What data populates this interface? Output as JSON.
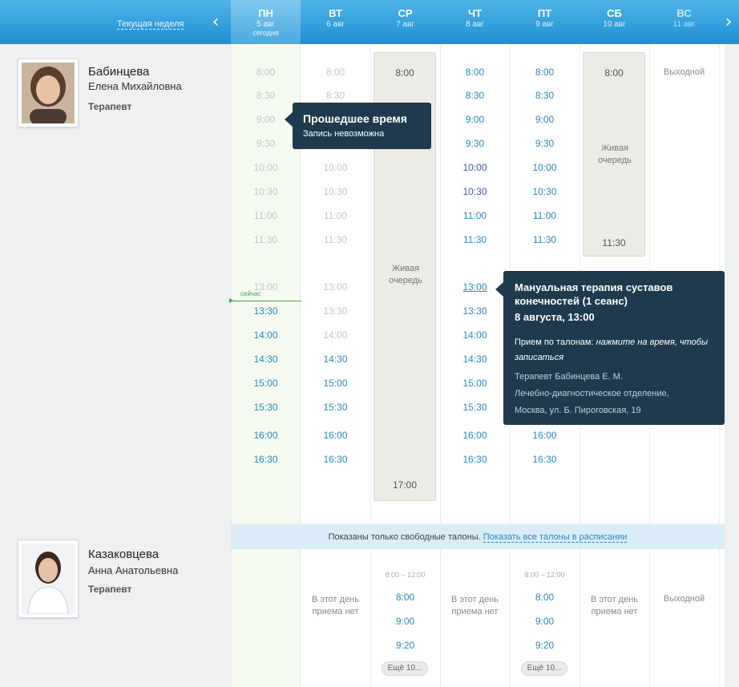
{
  "header": {
    "week_link": "Текущая неделя",
    "prev_icon": "chevron-left-icon",
    "next_icon": "chevron-right-icon",
    "days": [
      {
        "name": "ПН",
        "date": "5 авг",
        "note": "сегодня"
      },
      {
        "name": "ВТ",
        "date": "6 авг",
        "note": ""
      },
      {
        "name": "СР",
        "date": "7 авг",
        "note": ""
      },
      {
        "name": "ЧТ",
        "date": "8 авг",
        "note": ""
      },
      {
        "name": "ПТ",
        "date": "9 авг",
        "note": ""
      },
      {
        "name": "СБ",
        "date": "10 авг",
        "note": ""
      },
      {
        "name": "ВС",
        "date": "11 авг",
        "note": ""
      }
    ]
  },
  "doctor1": {
    "surname": "Бабинцева",
    "name": "Елена Михайловна",
    "spec": "Терапевт",
    "mon_past": [
      "8:00",
      "8:30",
      "9:00",
      "9:30",
      "10:00",
      "10:30",
      "11:00",
      "11:30",
      "13:00"
    ],
    "mon_free": [
      "13:30",
      "14:00",
      "14:30",
      "15:00",
      "15:30",
      "16:00",
      "16:30"
    ],
    "now_label": "сейчас",
    "tue_past": [
      "8:00",
      "8:30",
      "10:00",
      "10:30",
      "11:00",
      "11:30",
      "13:00",
      "13:30",
      "14:00"
    ],
    "tue_free": [
      "14:30",
      "15:00",
      "15:30",
      "16:00",
      "16:30"
    ],
    "wed_start": "8:00",
    "wed_live": "Живая очередь",
    "wed_end": "17:00",
    "thu_free_am": [
      "8:00",
      "8:30",
      "9:00",
      "9:30"
    ],
    "thu_busy": [
      "10:00",
      "10:30"
    ],
    "thu_free_mid": [
      "11:00",
      "11:30"
    ],
    "thu_selected": "13:00",
    "thu_free_pm": [
      "13:30",
      "14:00",
      "14:30",
      "15:00",
      "15:30",
      "16:00",
      "16:30"
    ],
    "fri_free": [
      "8:00",
      "8:30",
      "9:00",
      "9:30",
      "10:00",
      "10:30",
      "11:00",
      "11:30"
    ],
    "fri_free_pm": [
      "16:00",
      "16:30"
    ],
    "sat_start": "8:00",
    "sat_live": "Живая очередь",
    "sat_end": "11:30",
    "sun": "Выходной"
  },
  "tooltip_past": {
    "title": "Прошедшее время",
    "sub": "Запись невозможна"
  },
  "tooltip_slot": {
    "title": "Мануальная терапия суставов конечностей (1 сеанс)",
    "date": "8 августа, 13:00",
    "rule": "Прием по талонам: ",
    "rule_em": "нажмите на время, чтобы записаться",
    "doctor": "Терапевт Бабинцева Е. М.",
    "dept": "Лечебно-диагностическое отделение,",
    "address": "Москва, ул. Б. Пироговская, 19"
  },
  "notice": {
    "text": "Показаны только свободные талоны.",
    "link": "Показать все талоны в расписании"
  },
  "doctor2": {
    "surname": "Казаковцева",
    "name": "Анна Анатольевна",
    "spec": "Терапевт",
    "no_reception": "В этот день приема нет",
    "range": "8:00 – 12:00",
    "slots": [
      "8:00",
      "9:00",
      "9:20"
    ],
    "more": "Ещё 10...",
    "sun": "Выходной"
  }
}
